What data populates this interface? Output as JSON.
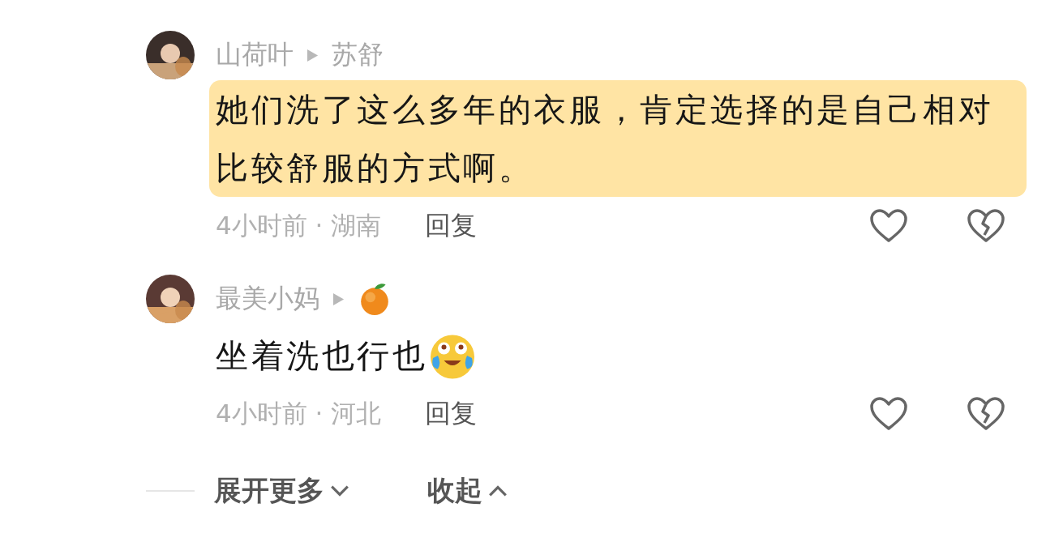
{
  "comments": [
    {
      "author": "山荷叶",
      "reply_to": {
        "kind": "name",
        "text": "苏舒"
      },
      "text": "她们洗了这么多年的衣服，肯定选择的是自己相对比较舒服的方式啊。",
      "trailing_emoji": false,
      "highlighted": true,
      "meta": "4小时前 · 湖南",
      "reply_label": "回复"
    },
    {
      "author": "最美小妈",
      "reply_to": {
        "kind": "orange"
      },
      "text": "坐着洗也行也",
      "trailing_emoji": true,
      "highlighted": false,
      "meta": "4小时前 · 河北",
      "reply_label": "回复"
    }
  ],
  "footer": {
    "expand": "展开更多",
    "collapse": "收起"
  }
}
